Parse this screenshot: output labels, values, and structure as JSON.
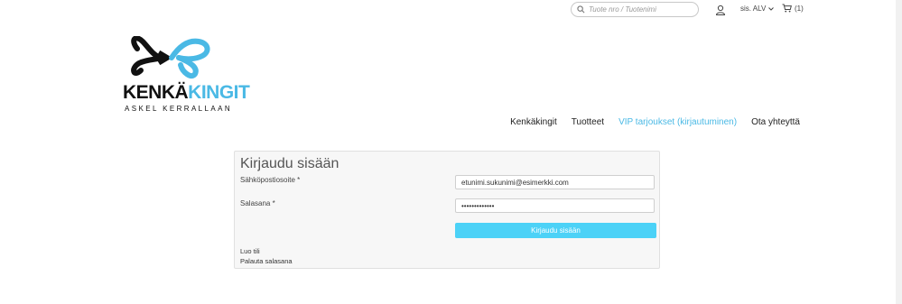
{
  "header": {
    "search_placeholder": "Tuote nro / Tuotenimi",
    "vat_label": "sis. ALV",
    "cart_count": "(1)"
  },
  "logo": {
    "brand_dark": "KENKÄ",
    "brand_light": "KINGIT",
    "tagline": "ASKEL KERRALLAAN"
  },
  "nav": {
    "items": [
      {
        "label": "Kenkäkingit"
      },
      {
        "label": "Tuotteet"
      },
      {
        "label": "VIP tarjoukset (kirjautuminen)"
      },
      {
        "label": "Ota yhteyttä"
      }
    ]
  },
  "login": {
    "title": "Kirjaudu sisään",
    "email_label": "Sähköpostiosoite *",
    "email_value": "etunimi.sukunimi@esimerkki.com",
    "password_label": "Salasana *",
    "password_value": "•••••••••••••",
    "submit_label": "Kirjaudu sisään",
    "create_account_link": "Luo tili",
    "reset_password_link": "Palauta salasana"
  },
  "colors": {
    "accent": "#4ab9e5",
    "button": "#4cd2f7"
  }
}
